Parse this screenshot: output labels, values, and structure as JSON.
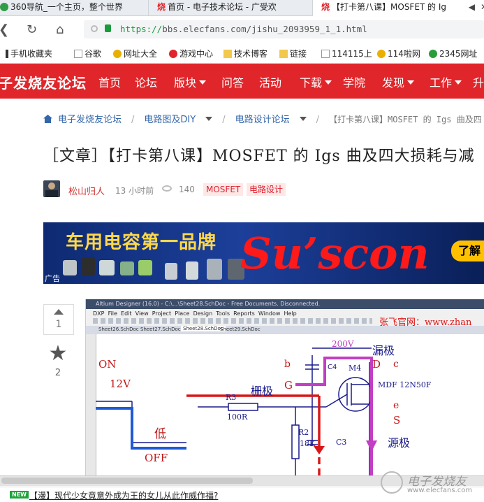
{
  "tabs": [
    {
      "label": "360导航_一个主页，整个世界",
      "active": false
    },
    {
      "label": "首页 - 电子技术论坛 - 广受欢",
      "active": false
    },
    {
      "label": "【打卡第八课】MOSFET 的 Ig",
      "active": true
    }
  ],
  "nav": {
    "url_scheme": "https://",
    "url_rest": "bbs.elecfans.com/jishu_2093959_1_1.html"
  },
  "bookmarks": [
    "手机收藏夹",
    "谷歌",
    "网址大全",
    "游戏中心",
    "技术博客",
    "链接",
    "114115上",
    "114啦网",
    "2345网址"
  ],
  "site": {
    "logo": "子发烧友论坛",
    "menu": [
      {
        "label": "首页",
        "dropdown": false
      },
      {
        "label": "论坛",
        "dropdown": false
      },
      {
        "label": "版块",
        "dropdown": true
      },
      {
        "label": "问答",
        "dropdown": false
      },
      {
        "label": "活动",
        "dropdown": false
      },
      {
        "label": "下载",
        "dropdown": true
      },
      {
        "label": "学院",
        "dropdown": false
      },
      {
        "label": "发现",
        "dropdown": true
      },
      {
        "label": "工作",
        "dropdown": true
      },
      {
        "label": "升",
        "dropdown": false
      }
    ]
  },
  "breadcrumb": {
    "home": "电子发烧友论坛",
    "l2": "电路图及DIY",
    "l3": "电路设计论坛",
    "current": "【打卡第八课】MOSFET 的 Igs 曲及四"
  },
  "article": {
    "title": "［文章］【打卡第八课】MOSFET 的 Igs 曲及四大损耗与减",
    "author": "松山归人",
    "time": "13 小时前",
    "views": "140",
    "tags": [
      "MOSFET",
      "电路设计"
    ],
    "upvotes": "1",
    "favorites": "2"
  },
  "ad": {
    "headline": "车用电容第一品牌",
    "brand": "Su’scon",
    "cta": "了解",
    "label": "广告"
  },
  "screenshot": {
    "titlebar": "Altium Designer (16.0) - C:\\...\\Sheet28.SchDoc - Free Documents. Disconnected.",
    "menu": [
      "DXP",
      "File",
      "Edit",
      "View",
      "Project",
      "Place",
      "Design",
      "Tools",
      "Reports",
      "Window",
      "Help"
    ],
    "doc_tabs": [
      "Sheet26.SchDoc",
      "Sheet27.SchDoc",
      "Sheet28.SchDoc",
      "Sheet29.SchDoc"
    ],
    "watermark": "张飞官网：www.zhan",
    "labels": {
      "voltage": "200V",
      "drain_cn": "漏极",
      "b": "b",
      "c": "c",
      "d": "D",
      "g": "G",
      "e": "e",
      "s": "S",
      "gate_cn": "栅极",
      "source_cn": "源极",
      "c4": "C4",
      "m4": "M4",
      "part": "MDF 12N50F",
      "on": "ON",
      "v12": "12V",
      "r3": "R3",
      "r3_val": "100R",
      "low": "低",
      "off": "OFF",
      "r2": "R2",
      "r2_val": "18K",
      "c3": "C3"
    }
  },
  "footer": {
    "badge": "NEW",
    "news": "【漫】现代少女竟意外成为王的女儿从此作威作福?",
    "logo_text": "电子发烧友",
    "logo_url": "www.elecfans.com"
  },
  "colors": {
    "brand_red": "#e0262b",
    "link_blue": "#3366aa",
    "tag_red": "#d22233"
  }
}
